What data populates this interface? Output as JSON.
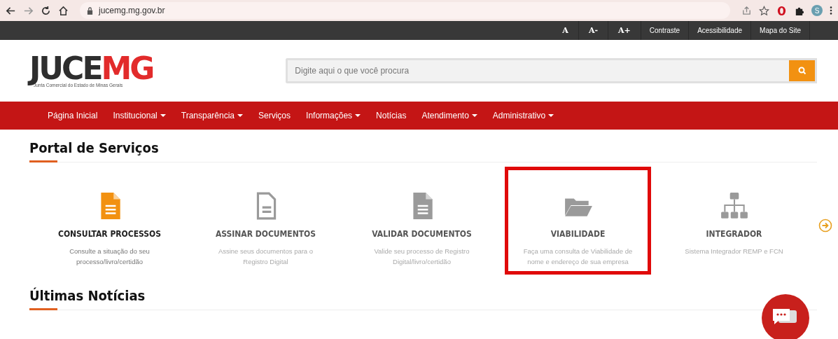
{
  "browser": {
    "url": "jucemg.mg.gov.br",
    "profile": "S"
  },
  "top_bar": {
    "font_buttons": [
      "A",
      "A-",
      "A+"
    ],
    "links": [
      "Contraste",
      "Acessibilidade",
      "Mapa do Site"
    ]
  },
  "header": {
    "logo": {
      "main": "JUCE",
      "accent": "MG",
      "subtitle": "Junta Comercial do Estado de Minas Gerais"
    },
    "search": {
      "placeholder": "Digite aqui o que você procura"
    }
  },
  "nav": [
    {
      "label": "Página Inicial",
      "dropdown": false
    },
    {
      "label": "Institucional",
      "dropdown": true
    },
    {
      "label": "Transparência",
      "dropdown": true
    },
    {
      "label": "Serviços",
      "dropdown": false
    },
    {
      "label": "Informações",
      "dropdown": true
    },
    {
      "label": "Notícias",
      "dropdown": false
    },
    {
      "label": "Atendimento",
      "dropdown": true
    },
    {
      "label": "Administrativo",
      "dropdown": true
    }
  ],
  "services_section": {
    "title": "Portal de Serviços",
    "services": [
      {
        "kind": "document",
        "title": "CONSULTAR PROCESSOS",
        "description": "Consulte a situação do seu processo/livro/certidão",
        "featured": true,
        "highlighted": false
      },
      {
        "kind": "document-outline",
        "title": "ASSINAR DOCUMENTOS",
        "description": "Assine seus documentos para o Registro Digital",
        "featured": false,
        "highlighted": false
      },
      {
        "kind": "document",
        "title": "VALIDAR DOCUMENTOS",
        "description": "Valide seu processo de Registro Digital/livro/certidão",
        "featured": false,
        "highlighted": false
      },
      {
        "kind": "folder",
        "title": "VIABILIDADE",
        "description": "Faça uma consulta de Viabilidade de nome e endereço de sua empresa",
        "featured": false,
        "highlighted": true
      },
      {
        "kind": "sitemap",
        "title": "INTEGRADOR",
        "description": "Sistema Integrador REMP e FCN",
        "featured": false,
        "highlighted": false
      }
    ]
  },
  "news_section": {
    "title": "Últimas Notícias"
  }
}
